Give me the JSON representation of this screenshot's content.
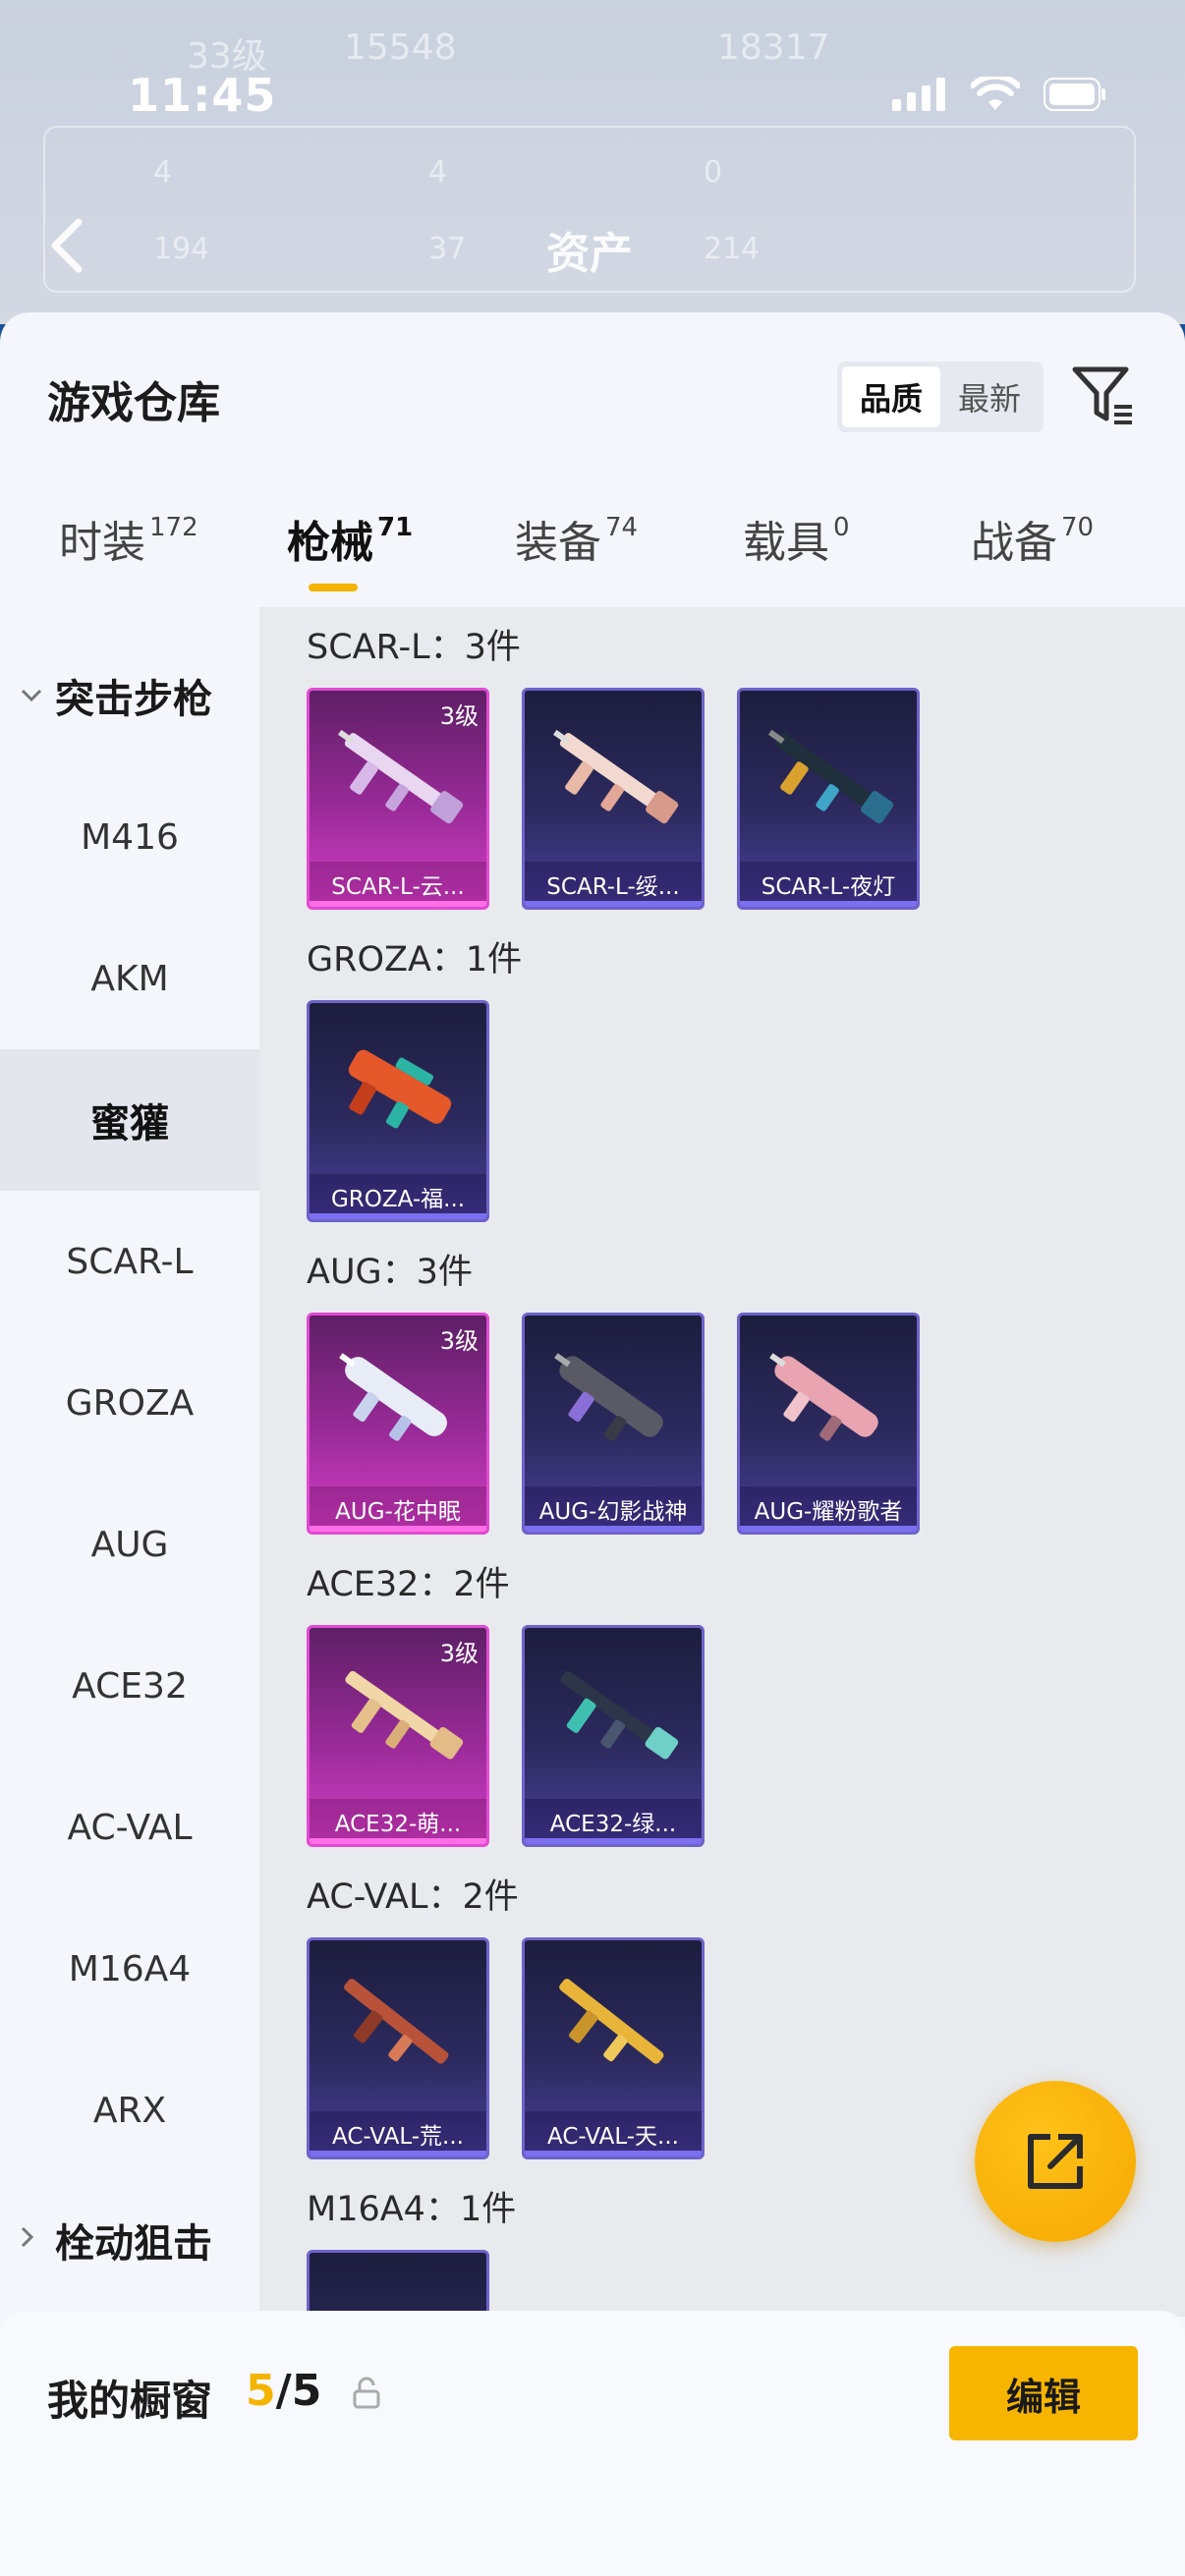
{
  "background": {
    "ghost_texts": [
      "33级",
      "15548",
      "18317",
      "4",
      "4",
      "0",
      "194",
      "37",
      "214"
    ],
    "title": "资产"
  },
  "status_bar": {
    "time": "11:45"
  },
  "sheet": {
    "title": "游戏仓库",
    "sort_options": [
      "品质",
      "最新"
    ],
    "sort_active": "品质"
  },
  "tabs": [
    {
      "label": "时装",
      "count": "172"
    },
    {
      "label": "枪械",
      "count": "71"
    },
    {
      "label": "装备",
      "count": "74"
    },
    {
      "label": "载具",
      "count": "0"
    },
    {
      "label": "战备",
      "count": "70"
    }
  ],
  "sidebar": {
    "category_open": "突击步枪",
    "items": [
      "M416",
      "AKM",
      "蜜獾",
      "SCAR-L",
      "GROZA",
      "AUG",
      "ACE32",
      "AC-VAL",
      "M16A4",
      "ARX"
    ],
    "active_item": "蜜獾",
    "category_closed": "栓动狙击"
  },
  "groups": [
    {
      "title": "SCAR-L：3件",
      "cards": [
        {
          "name": "SCAR-L-云...",
          "level": "3级",
          "style": "pink"
        },
        {
          "name": "SCAR-L-绥...",
          "level": "",
          "style": "purple"
        },
        {
          "name": "SCAR-L-夜灯",
          "level": "",
          "style": "purple"
        }
      ]
    },
    {
      "title": "GROZA：1件",
      "cards": [
        {
          "name": "GROZA-福...",
          "level": "",
          "style": "purple"
        }
      ]
    },
    {
      "title": "AUG：3件",
      "cards": [
        {
          "name": "AUG-花中眠",
          "level": "3级",
          "style": "pink"
        },
        {
          "name": "AUG-幻影战神",
          "level": "",
          "style": "purple"
        },
        {
          "name": "AUG-耀粉歌者",
          "level": "",
          "style": "purple"
        }
      ]
    },
    {
      "title": "ACE32：2件",
      "cards": [
        {
          "name": "ACE32-萌...",
          "level": "3级",
          "style": "pink"
        },
        {
          "name": "ACE32-绿...",
          "level": "",
          "style": "purple"
        }
      ]
    },
    {
      "title": "AC-VAL：2件",
      "cards": [
        {
          "name": "AC-VAL-荒...",
          "level": "",
          "style": "purple"
        },
        {
          "name": "AC-VAL-天...",
          "level": "",
          "style": "purple"
        }
      ]
    },
    {
      "title": "M16A4：1件",
      "cards": []
    }
  ],
  "bottom_bar": {
    "label": "我的橱窗",
    "current": "5",
    "total": "/5",
    "edit_label": "编辑"
  },
  "colors": {
    "accent": "#f4b400",
    "card_purple": "#6e63c9",
    "card_pink": "#e04bd2"
  }
}
